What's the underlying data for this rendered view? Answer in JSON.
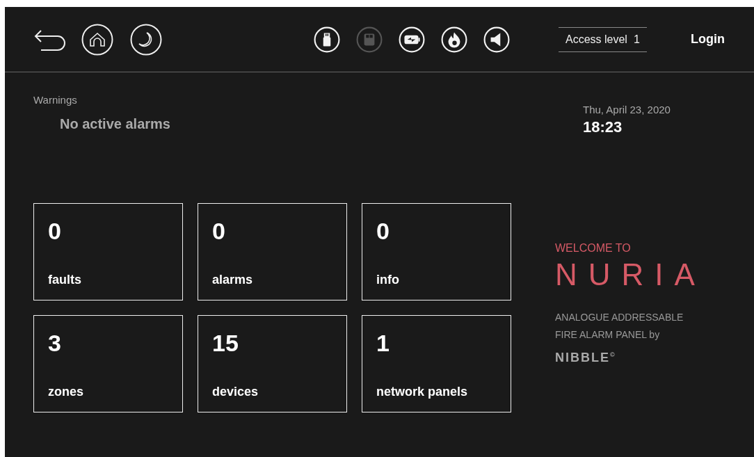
{
  "header": {
    "nav_icons": [
      {
        "kind": "back"
      },
      {
        "kind": "home"
      },
      {
        "kind": "night"
      }
    ],
    "status_icons": [
      {
        "kind": "usb",
        "active": true
      },
      {
        "kind": "sdcard",
        "active": false
      },
      {
        "kind": "battery",
        "active": true
      },
      {
        "kind": "fire",
        "active": true
      },
      {
        "kind": "sounder",
        "active": true
      }
    ],
    "access_level": {
      "label": "Access level",
      "value": "1"
    },
    "login": "Login"
  },
  "warnings": {
    "title": "Warnings",
    "message": "No active alarms"
  },
  "datetime": {
    "date": "Thu, April 23, 2020",
    "time": "18:23"
  },
  "tiles": [
    {
      "count": "0",
      "label": "faults"
    },
    {
      "count": "0",
      "label": "alarms"
    },
    {
      "count": "0",
      "label": "info"
    },
    {
      "count": "3",
      "label": "zones"
    },
    {
      "count": "15",
      "label": "devices"
    },
    {
      "count": "1",
      "label": "network panels"
    }
  ],
  "brand": {
    "welcome": "WELCOME TO",
    "product": "NURIA",
    "description_lines": [
      "ANALOGUE ADDRESSABLE",
      "FIRE ALARM PANEL by"
    ],
    "maker": "NIBBLE$^{©}$"
  }
}
